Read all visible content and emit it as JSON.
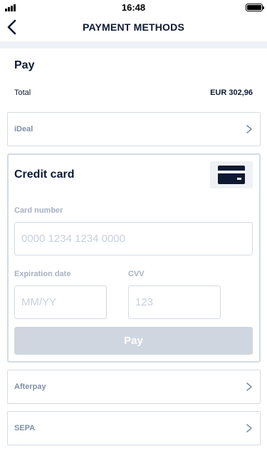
{
  "status_bar": {
    "time": "16:48"
  },
  "header": {
    "title": "PAYMENT METHODS"
  },
  "summary": {
    "heading": "Pay",
    "total_label": "Total",
    "total_value": "EUR 302,96"
  },
  "methods": [
    {
      "label": "iDeal"
    },
    {
      "label": "Afterpay"
    },
    {
      "label": "SEPA"
    }
  ],
  "credit_card": {
    "title": "Credit card",
    "icon": "credit-card-icon",
    "card_number_label": "Card number",
    "card_number_placeholder": "0000 1234 1234 0000",
    "card_number_value": "",
    "expiration_label": "Expiration date",
    "expiration_placeholder": "MM/YY",
    "expiration_value": "",
    "cvv_label": "CVV",
    "cvv_placeholder": "123",
    "cvv_value": "",
    "pay_button_label": "Pay"
  },
  "colors": {
    "primary_text": "#0e1a33",
    "muted_text": "#7f8fa6",
    "border": "#d5dbe3",
    "band": "#eef2f6",
    "disabled_button": "#d0d6df"
  }
}
